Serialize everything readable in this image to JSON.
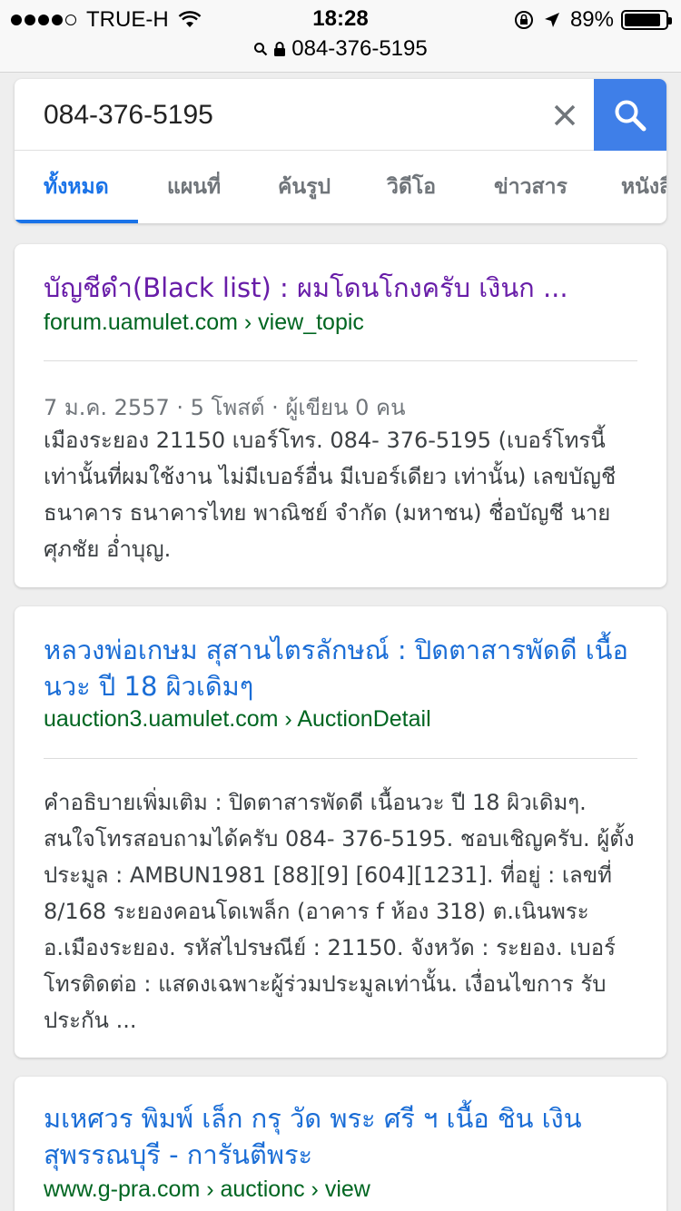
{
  "status_bar": {
    "carrier": "TRUE-H",
    "time": "18:28",
    "battery": "89%",
    "battery_level": 0.89
  },
  "url_bar": {
    "url": "084-376-5195"
  },
  "search": {
    "query": "084-376-5195",
    "tabs": [
      "ทั้งหมด",
      "แผนที่",
      "ค้นรูป",
      "วิดีโอ",
      "ข่าวสาร",
      "หนังสือ"
    ],
    "active_tab": "ทั้งหมด"
  },
  "results": [
    {
      "title": "บัญชีดำ(Black list) : ผมโดนโกงครับ เงินก ...",
      "url": "forum.uamulet.com › view_topic",
      "meta": "7 ม.ค. 2557 · 5 โพสต์ · ผู้เขียน 0 คน",
      "snippet": "เมืองระยอง 21150 เบอร์โทร. 084- 376-5195 (เบอร์โทรนี้เท่านั้นที่ผมใช้งาน ไม่มีเบอร์อื่น มีเบอร์เดียว เท่านั้น) เลขบัญชี ธนาคาร ธนาคารไทย พาณิชย์ จำกัด (มหาชน) ชื่อบัญชี นาย ศุภชัย อ่ำบุญ."
    },
    {
      "title": "หลวงพ่อเกษม สุสานไตรลักษณ์ : ปิดตาสารพัดดี เนื้อนวะ ปี 18 ผิวเดิมๆ",
      "url": "uauction3.uamulet.com › AuctionDetail",
      "snippet": "คำอธิบายเพิ่มเติม : ปิดตาสารพัดดี เนื้อนวะ ปี 18 ผิวเดิมๆ. สนใจโทรสอบถามได้ครับ 084- 376-5195. ชอบเชิญครับ. ผู้ตั้งประมูล : AMBUN1981 [88][9] [604][1231]. ที่อยู่ : เลขที่ 8/168 ระยองคอนโดเพล็ก (อาคาร f ห้อง 318) ต.เนินพระ อ.เมืองระยอง. รหัสไปรษณีย์ : 21150. จังหวัด : ระยอง. เบอร์โทรติดต่อ : แสดงเฉพาะผู้ร่วมประมูลเท่านั้น. เงื่อนไขการ รับประกัน ..."
    },
    {
      "title": "มเหศวร พิมพ์ เล็ก กรุ วัด พระ ศรี ฯ เนื้อ ชิน เงิน สุพรรณบุรี - การันตีพระ",
      "url": "www.g-pra.com › auctionc › view"
    }
  ]
}
